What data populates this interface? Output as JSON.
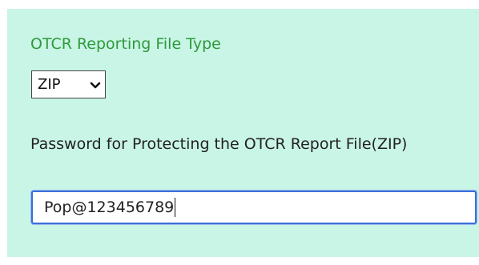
{
  "reporting_file_type": {
    "label": "OTCR Reporting File Type",
    "selected_value": "ZIP",
    "chevron_icon": "chevron-down-icon"
  },
  "password": {
    "label": "Password for Protecting the OTCR Report File(ZIP)",
    "value": "Pop@123456789"
  },
  "colors": {
    "panel_background": "#c9f5e6",
    "label_green": "#2e9a3a",
    "focus_border": "#3b6fd8"
  }
}
